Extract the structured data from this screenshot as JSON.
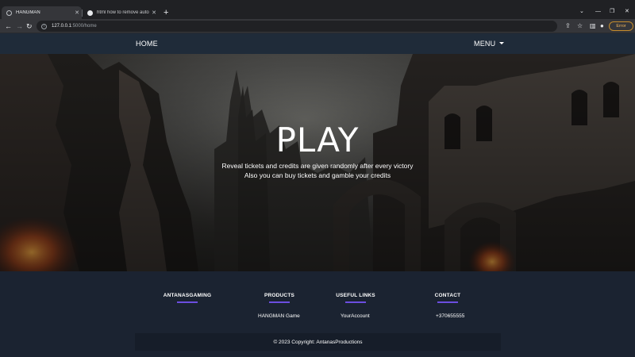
{
  "browser": {
    "tabs": [
      {
        "title": "HANGMAN",
        "active": true
      },
      {
        "title": "html how to remove auto sugge",
        "active": false
      }
    ],
    "new_tab": "+",
    "window_controls": {
      "minimize": "—",
      "restore": "❐",
      "close": "✕",
      "chevron": "⌄"
    },
    "url_host": "127.0.0.1",
    "url_path": ":5000/home",
    "error_button": "Error"
  },
  "nav": {
    "home": "HOME",
    "menu": "MENU"
  },
  "hero": {
    "title": "PLAY",
    "line1": "Reveal tickets and credits are given randomly after every victory",
    "line2": "Also you can buy tickets and gamble your credits"
  },
  "footer": {
    "columns": [
      {
        "heading": "ANTANASGAMING",
        "link": ""
      },
      {
        "heading": "PRODUCTS",
        "link": "HANGMAN Game"
      },
      {
        "heading": "USEFUL LINKS",
        "link": "YourAccount"
      },
      {
        "heading": "CONTACT",
        "link": "+370655555"
      }
    ],
    "copyright": "© 2023 Copyright: AntanasProductions"
  },
  "colors": {
    "navbar": "#1f2b39",
    "footer": "#1b2331",
    "accent_underline": "#6c4ee0"
  }
}
